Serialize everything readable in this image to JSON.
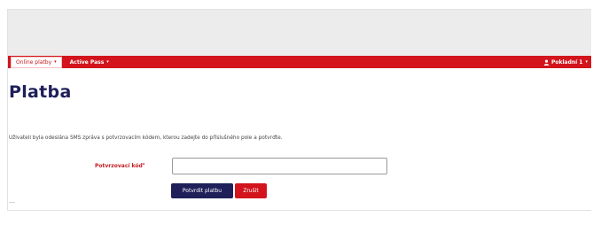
{
  "navbar": {
    "menu_online": "Online platby",
    "menu_active_pass": "Active Pass",
    "user_label": "Pokladní 1",
    "caret": "▾"
  },
  "page": {
    "title": "Platba",
    "info": "Uživateli byla odeslána SMS zpráva s potvrzovacím kódem, kterou zadejte do příslušného pole a potvrďte."
  },
  "form": {
    "code_label": "Potvrzovací kód",
    "required_mark": "*",
    "code_value": "",
    "confirm_label": "Potvrdit platbu",
    "cancel_label": "Zrušit"
  },
  "colors": {
    "nav_red": "#d3141c",
    "navy": "#1f1f5a"
  },
  "icons": {
    "user": "user-icon"
  }
}
